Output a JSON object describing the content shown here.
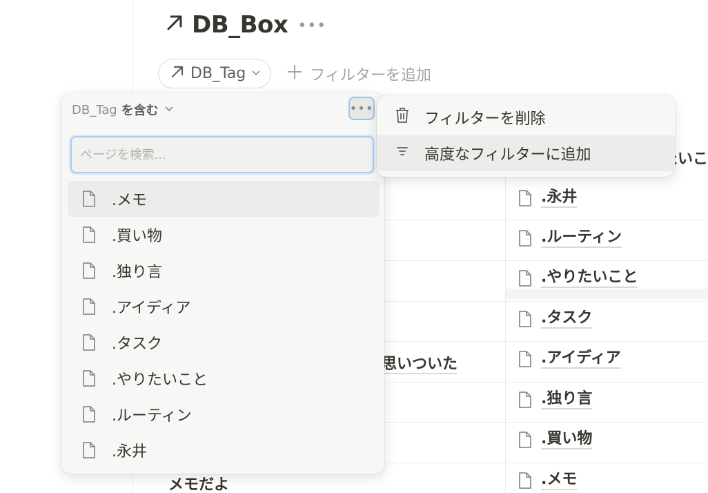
{
  "page": {
    "title": "DB_Box",
    "title_icon": "arrow-up-right-icon",
    "more_icon": "ellipsis-icon"
  },
  "filter_bar": {
    "chip_label": "DB_Tag",
    "add_filter_label": "フィルターを追加"
  },
  "filter_popup": {
    "property": "DB_Tag",
    "operator": "を含む",
    "search_placeholder": "ページを検索...",
    "options": [
      ".メモ",
      ".買い物",
      ".独り言",
      ".アイディア",
      ".タスク",
      ".やりたいこと",
      ".ルーティン",
      ".永井"
    ],
    "hovered_index": 0
  },
  "context_menu": {
    "items": [
      {
        "label": "フィルターを削除",
        "icon": "trash-icon"
      },
      {
        "label": "高度なフィルターに追加",
        "icon": "filter-lines-icon"
      }
    ],
    "hovered_index": 1
  },
  "background_table": {
    "header_partial": "たいこ",
    "left_cells": [
      "思いついた",
      "メモだよ"
    ],
    "right_cells": [
      ".永井",
      ".ルーティン",
      ".やりたいこと",
      ".タスク",
      ".アイディア",
      ".独り言",
      ".買い物",
      ".メモ"
    ]
  },
  "colors": {
    "text": "#37352f",
    "muted": "#9b9a97",
    "popup_bg": "#f7f7f6",
    "focus_ring": "#a9cdf2"
  }
}
